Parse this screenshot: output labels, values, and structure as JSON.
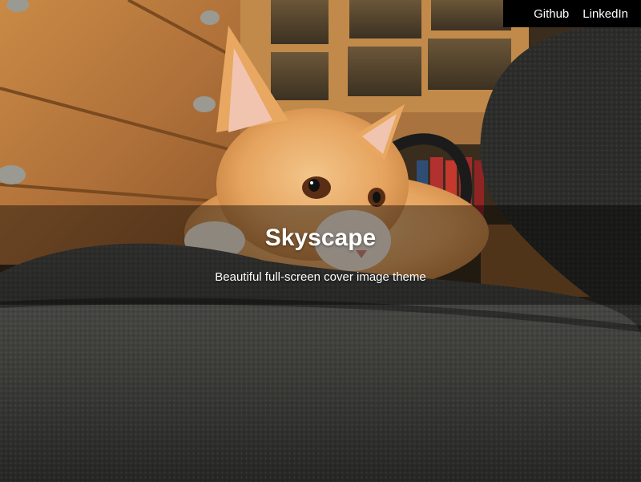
{
  "nav": {
    "links": [
      {
        "label": "Github"
      },
      {
        "label": "LinkedIn"
      }
    ],
    "background": "#000000"
  },
  "hero": {
    "title": "Skyscape",
    "subtitle": "Beautiful full-screen cover image theme",
    "overlay_color": "rgba(0,0,0,0.42)",
    "text_color": "#ffffff"
  },
  "cover_image": {
    "subject": "orange-cat-on-chair"
  }
}
